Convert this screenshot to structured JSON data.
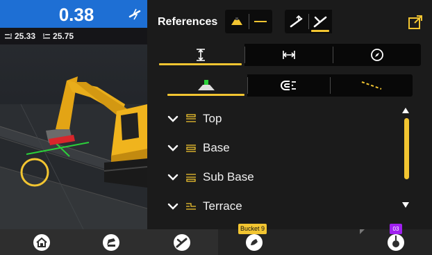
{
  "measure": {
    "value": "0.38",
    "left_value": "25.33",
    "right_value": "25.75"
  },
  "panel": {
    "title": "References",
    "tabs_row1": [
      "vertical-distance",
      "horizontal-distance",
      "compass"
    ],
    "tabs_row2": [
      "surface",
      "magnet",
      "line"
    ]
  },
  "layers": [
    {
      "label": "Top"
    },
    {
      "label": "Base"
    },
    {
      "label": "Sub Base"
    },
    {
      "label": "Terrace"
    }
  ],
  "bottom": {
    "bucket_badge": "Bucket 9",
    "machine_badge": "03"
  },
  "colors": {
    "accent": "#f2c531",
    "measure_bg": "#1e6fd4",
    "badge_purple": "#a020f0"
  }
}
